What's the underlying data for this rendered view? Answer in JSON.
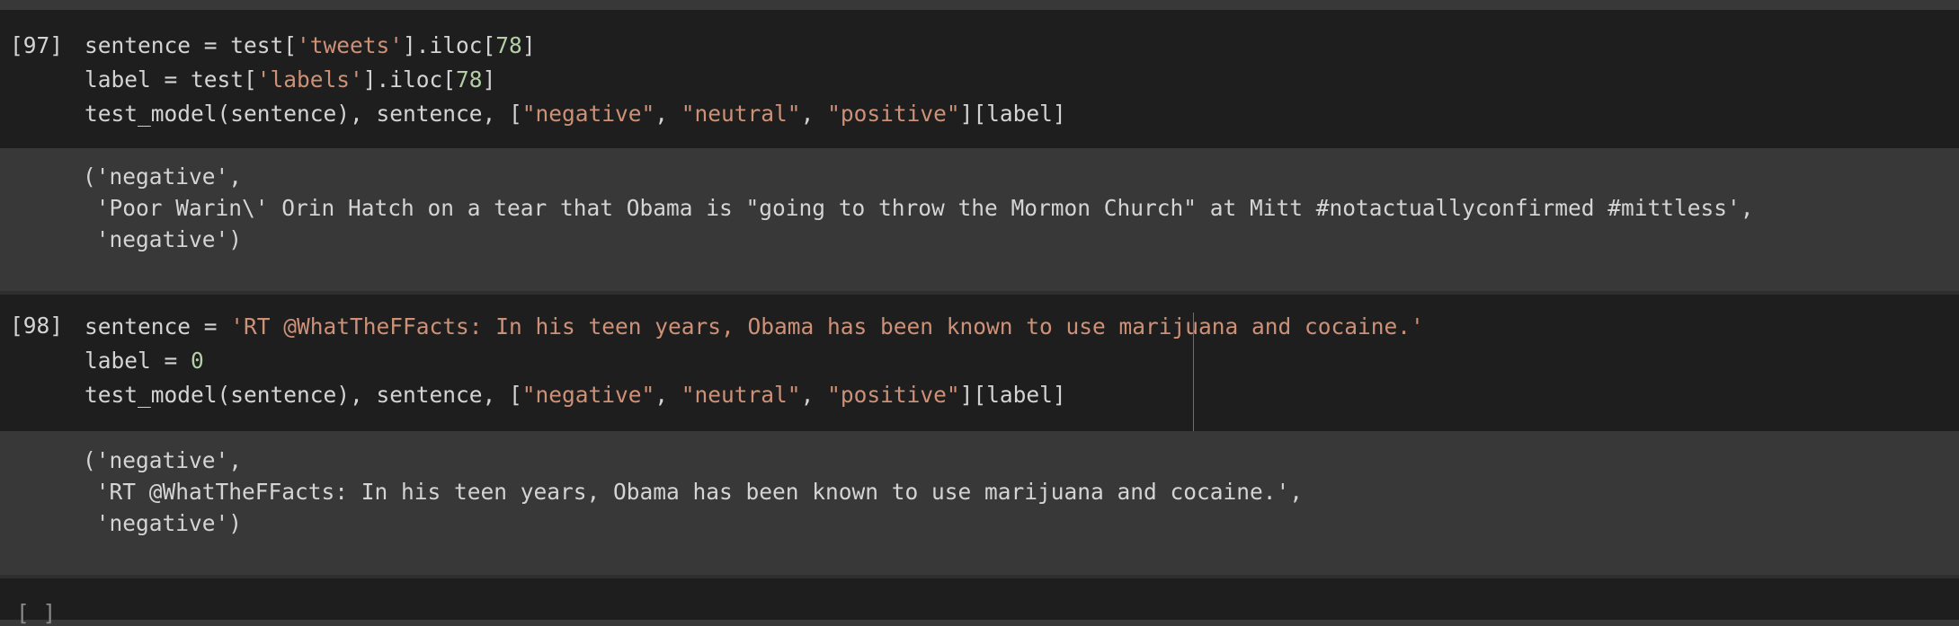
{
  "cells": [
    {
      "execution_count": "[97]",
      "code_lines": [
        [
          {
            "t": "sentence = test[",
            "k": "plain"
          },
          {
            "t": "'tweets'",
            "k": "str"
          },
          {
            "t": "].iloc[",
            "k": "plain"
          },
          {
            "t": "78",
            "k": "num"
          },
          {
            "t": "]",
            "k": "plain"
          }
        ],
        [
          {
            "t": "label = test[",
            "k": "plain"
          },
          {
            "t": "'labels'",
            "k": "str"
          },
          {
            "t": "].iloc[",
            "k": "plain"
          },
          {
            "t": "78",
            "k": "num"
          },
          {
            "t": "]",
            "k": "plain"
          }
        ],
        [
          {
            "t": "test_model(sentence), sentence, [",
            "k": "plain"
          },
          {
            "t": "\"negative\"",
            "k": "str"
          },
          {
            "t": ", ",
            "k": "plain"
          },
          {
            "t": "\"neutral\"",
            "k": "str"
          },
          {
            "t": ", ",
            "k": "plain"
          },
          {
            "t": "\"positive\"",
            "k": "str"
          },
          {
            "t": "][label]",
            "k": "plain"
          }
        ]
      ],
      "output_lines": [
        "('negative',",
        " 'Poor Warin\\' Orin Hatch on a tear that Obama is \"going to throw the Mormon Church\" at Mitt #notactuallyconfirmed #mittless',",
        " 'negative')"
      ]
    },
    {
      "execution_count": "[98]",
      "code_lines": [
        [
          {
            "t": "sentence = ",
            "k": "plain"
          },
          {
            "t": "'RT @WhatTheFFacts: In his teen years, Obama has been known to use marijuana and cocaine.'",
            "k": "str"
          }
        ],
        [
          {
            "t": "label = ",
            "k": "plain"
          },
          {
            "t": "0",
            "k": "num"
          }
        ],
        [
          {
            "t": "test_model(sentence), sentence, [",
            "k": "plain"
          },
          {
            "t": "\"negative\"",
            "k": "str"
          },
          {
            "t": ", ",
            "k": "plain"
          },
          {
            "t": "\"neutral\"",
            "k": "str"
          },
          {
            "t": ", ",
            "k": "plain"
          },
          {
            "t": "\"positive\"",
            "k": "str"
          },
          {
            "t": "][label]",
            "k": "plain"
          }
        ]
      ],
      "output_lines": [
        "('negative',",
        " 'RT @WhatTheFFacts: In his teen years, Obama has been known to use marijuana and cocaine.',",
        " 'negative')"
      ]
    }
  ],
  "empty_cell": {
    "execution_count": "[ ]"
  },
  "colors": {
    "code_background": "#1e1e1e",
    "output_background": "#383838",
    "text": "#d4d4d4",
    "string": "#ce9178",
    "number": "#b5cea8"
  }
}
